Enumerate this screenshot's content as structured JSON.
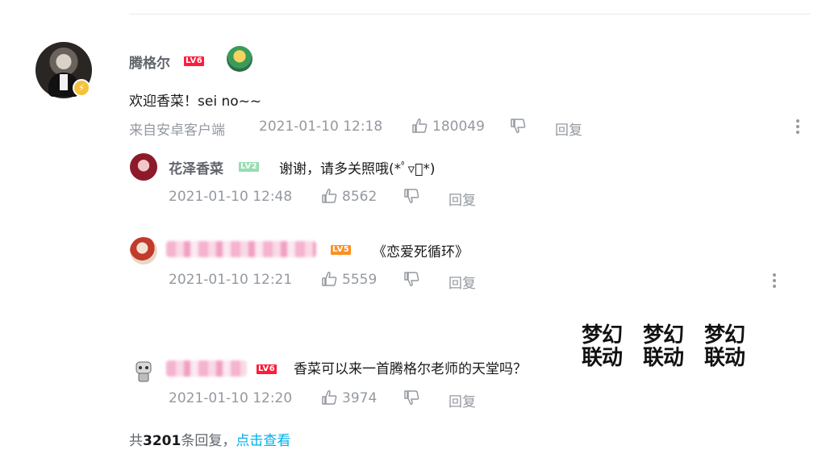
{
  "main": {
    "username": "腾格尔",
    "level": "LV6",
    "text": "欢迎香菜！sei no~~",
    "source": "来自安卓客户端",
    "time": "2021-01-10 12:18",
    "likes": "180049",
    "reply_label": "回复"
  },
  "replies": [
    {
      "username": "花泽香菜",
      "level": "LV2",
      "text": "谢谢，请多关照哦(*ﾟ▿ﾟ*)",
      "time": "2021-01-10 12:48",
      "likes": "8562",
      "reply_label": "回复"
    },
    {
      "level": "LV5",
      "text": "《恋爱死循环》",
      "time": "2021-01-10 12:21",
      "likes": "5559",
      "reply_label": "回复"
    },
    {
      "level": "LV6",
      "text": "香菜可以来一首腾格尔老师的天堂吗？",
      "time": "2021-01-10 12:20",
      "likes": "3974",
      "reply_label": "回复",
      "stickers": [
        {
          "line1": "梦幻",
          "line2": "联动"
        },
        {
          "line1": "梦幻",
          "line2": "联动"
        },
        {
          "line1": "梦幻",
          "line2": "联动"
        }
      ]
    }
  ],
  "footer": {
    "prefix": "共",
    "count": "3201",
    "suffix": "条回复，",
    "link": "点击查看"
  },
  "colors": {
    "link": "#00aeec",
    "lv6": "#ff1b3a",
    "lv5": "#ff8f1f",
    "lv2": "#95ddb2",
    "meta": "#9499a0"
  }
}
